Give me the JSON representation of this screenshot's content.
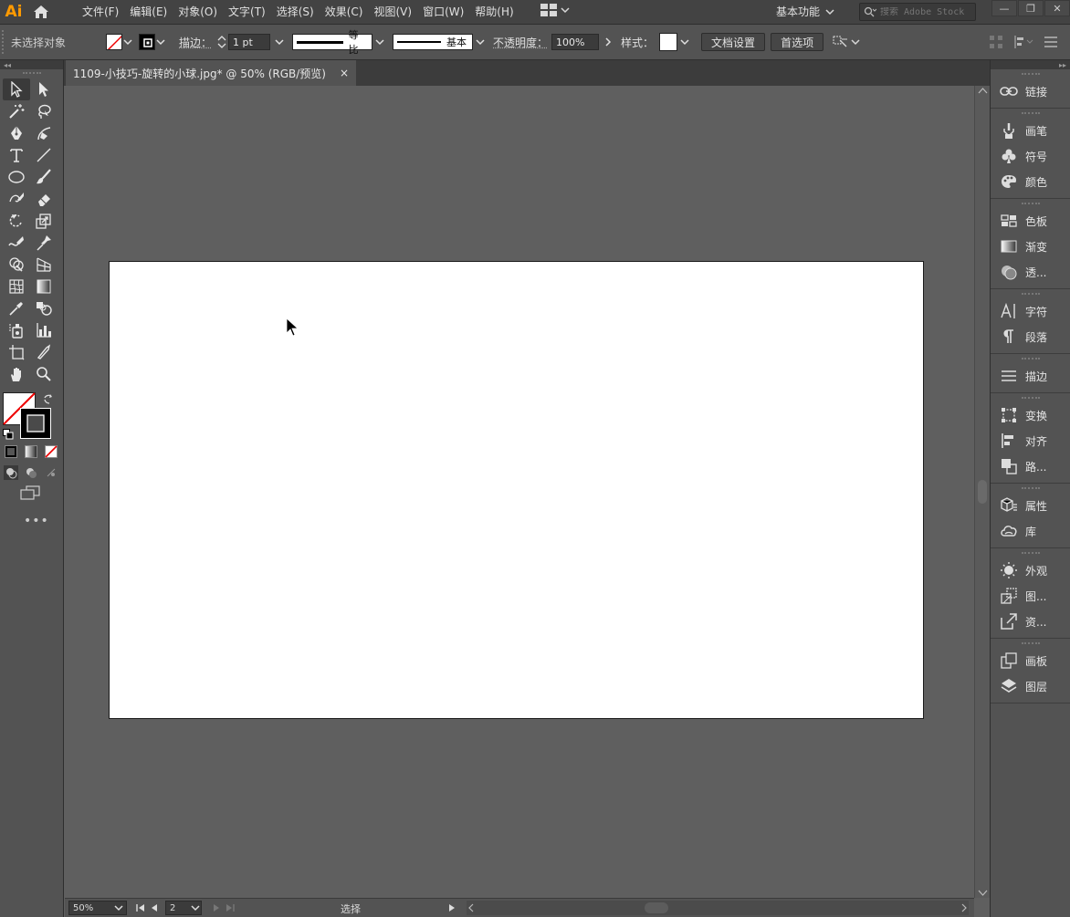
{
  "app": {
    "logo_text": "Ai",
    "brand_color": "#ff9a00",
    "workspace": "基本功能",
    "stock_placeholder": "搜索 Adobe Stock"
  },
  "menu": [
    "文件(F)",
    "编辑(E)",
    "对象(O)",
    "文字(T)",
    "选择(S)",
    "效果(C)",
    "视图(V)",
    "窗口(W)",
    "帮助(H)"
  ],
  "control": {
    "selection_state": "未选择对象",
    "stroke_label": "描边：",
    "stroke_weight": "1 pt",
    "stroke_profile": "等比",
    "brush": "基本",
    "opacity_label": "不透明度：",
    "opacity_value": "100%",
    "style_label": "样式：",
    "doc_setup": "文档设置",
    "preferences": "首选项"
  },
  "document": {
    "tab_title": "1109-小技巧-旋转的小球.jpg* @ 50% (RGB/预览)",
    "close_glyph": "×"
  },
  "status": {
    "zoom": "50%",
    "page": "2",
    "tool": "选择"
  },
  "panels": [
    [
      "链接"
    ],
    [
      "画笔",
      "符号",
      "颜色"
    ],
    [
      "色板",
      "渐变",
      "透..."
    ],
    [
      "字符",
      "段落"
    ],
    [
      "描边"
    ],
    [
      "变换",
      "对齐",
      "路..."
    ],
    [
      "属性",
      "库"
    ],
    [
      "外观",
      "图...",
      "资..."
    ],
    [
      "画板",
      "图层"
    ]
  ],
  "panel_icons": [
    [
      "link-icon"
    ],
    [
      "brush-icon",
      "symbol-icon",
      "color-icon"
    ],
    [
      "swatches-icon",
      "gradient-icon",
      "transparency-icon"
    ],
    [
      "character-icon",
      "paragraph-icon"
    ],
    [
      "stroke-icon"
    ],
    [
      "transform-icon",
      "align-icon",
      "pathfinder-icon"
    ],
    [
      "properties-icon",
      "libraries-icon"
    ],
    [
      "appearance-icon",
      "graphic-styles-icon",
      "asset-export-icon"
    ],
    [
      "artboards-icon",
      "layers-icon"
    ]
  ]
}
